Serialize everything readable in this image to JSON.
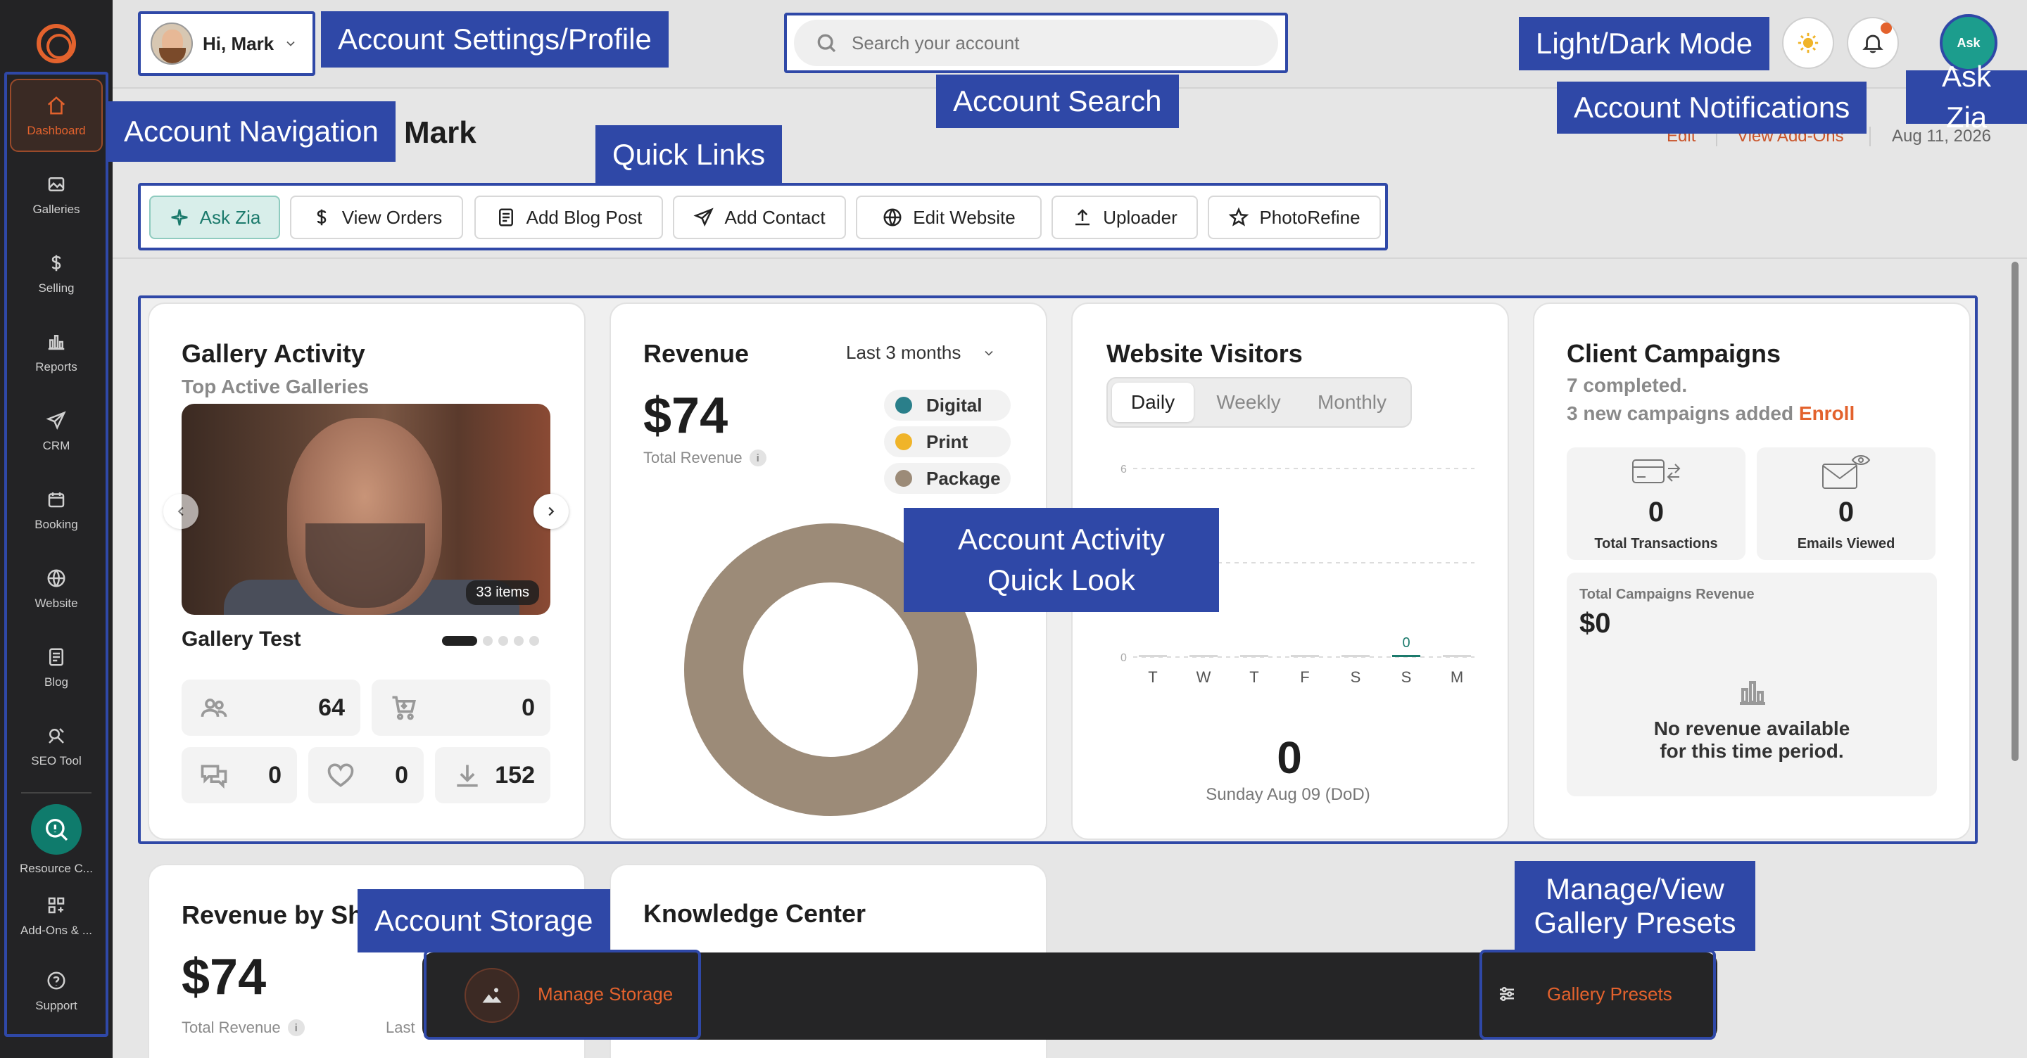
{
  "sidebar": {
    "items": [
      {
        "label": "Dashboard",
        "icon": "home-icon"
      },
      {
        "label": "Galleries",
        "icon": "gallery-icon"
      },
      {
        "label": "Selling",
        "icon": "dollar-icon"
      },
      {
        "label": "Reports",
        "icon": "bar-chart-icon"
      },
      {
        "label": "CRM",
        "icon": "send-icon"
      },
      {
        "label": "Booking",
        "icon": "calendar-icon"
      },
      {
        "label": "Website",
        "icon": "globe-icon"
      },
      {
        "label": "Blog",
        "icon": "document-icon"
      },
      {
        "label": "SEO Tool",
        "icon": "seo-icon"
      },
      {
        "label": "Resource C...",
        "icon": "resource-search-icon"
      },
      {
        "label": "Add-Ons & ...",
        "icon": "addons-grid-icon"
      },
      {
        "label": "Support",
        "icon": "help-icon"
      }
    ]
  },
  "header": {
    "greeting": "Hi, Mark",
    "search_placeholder": "Search your account"
  },
  "page": {
    "title_visible": "Mark",
    "links": [
      "Edit",
      "View Add-Ons"
    ],
    "date": "Aug 11, 2026"
  },
  "quick_links": [
    "Ask Zia",
    "View Orders",
    "Add Blog Post",
    "Add Contact",
    "Edit Website",
    "Uploader",
    "PhotoRefine"
  ],
  "gallery_activity": {
    "title": "Gallery Activity",
    "subtitle": "Top Active Galleries",
    "items_badge": "33 items",
    "gallery_name": "Gallery Test",
    "stats": {
      "visitors": "64",
      "orders": "0",
      "comments": "0",
      "favorites": "0",
      "downloads": "152"
    }
  },
  "revenue": {
    "title": "Revenue",
    "period": "Last 3 months",
    "total": "$74",
    "total_label": "Total Revenue",
    "legend": [
      {
        "label": "Digital",
        "color": "#2a7f8a"
      },
      {
        "label": "Print",
        "color": "#f0b429"
      },
      {
        "label": "Package",
        "color": "#9c8b78"
      }
    ]
  },
  "website_visitors": {
    "title": "Website Visitors",
    "tabs": [
      "Daily",
      "Weekly",
      "Monthly"
    ],
    "total": "0",
    "date_label": "Sunday Aug 09 (DoD)"
  },
  "client_campaigns": {
    "title": "Client Campaigns",
    "completed": "7 completed.",
    "new_text": "3 new campaigns added",
    "enroll": "Enroll",
    "tiles": [
      {
        "value": "0",
        "label": "Total Transactions"
      },
      {
        "value": "0",
        "label": "Emails Viewed"
      }
    ],
    "revenue_label": "Total Campaigns Revenue",
    "revenue_value": "$0",
    "no_revenue_line1": "No revenue available",
    "no_revenue_line2": "for this time period."
  },
  "revenue_by_shop": {
    "title_visible": "Revenue by Sh",
    "total": "$74",
    "total_label": "Total Revenue",
    "partial_label": "Last"
  },
  "knowledge_center": {
    "title": "Knowledge Center"
  },
  "bottom_bar": {
    "manage_storage": "Manage Storage",
    "gallery_presets": "Gallery Presets"
  },
  "callouts": {
    "account_settings": "Account Settings/Profile",
    "account_search": "Account Search",
    "light_dark": "Light/Dark Mode",
    "notifications": "Account Notifications",
    "ask_zia": "Ask Zia",
    "account_nav": "Account Navigation",
    "quick_links": "Quick Links",
    "activity_line1": "Account Activity",
    "activity_line2": "Quick Look",
    "account_storage": "Account Storage",
    "presets_line1": "Manage/View",
    "presets_line2": "Gallery Presets"
  },
  "chart_data": [
    {
      "type": "pie",
      "title": "Revenue",
      "categories": [
        "Digital",
        "Print",
        "Package"
      ],
      "values": [
        0,
        0,
        74
      ]
    },
    {
      "type": "bar",
      "title": "Website Visitors",
      "categories": [
        "T",
        "W",
        "T",
        "F",
        "S",
        "S",
        "M"
      ],
      "values": [
        0,
        0,
        0,
        0,
        0,
        0,
        0
      ],
      "ylim": [
        0,
        6
      ],
      "y_ticks": [
        "0",
        "6"
      ],
      "highlighted_label": "0"
    }
  ]
}
